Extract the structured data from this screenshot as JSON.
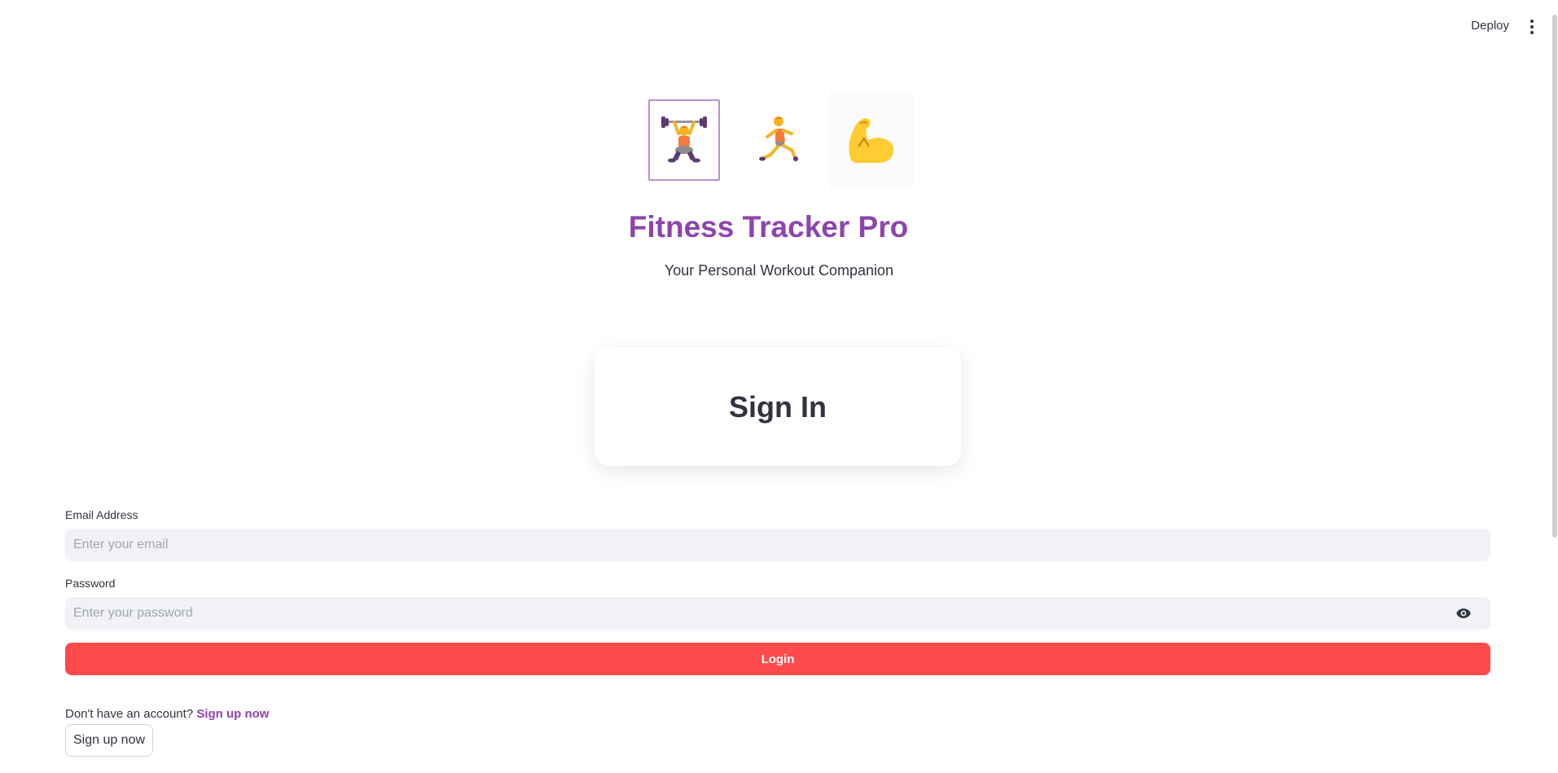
{
  "header": {
    "deploy_label": "Deploy",
    "menu_icon": "kebab-menu-icon"
  },
  "hero": {
    "icons": [
      "weightlifter-icon",
      "runner-icon",
      "flexed-biceps-icon"
    ],
    "title": "Fitness Tracker Pro",
    "subtitle": "Your Personal Workout Companion"
  },
  "card": {
    "heading": "Sign In"
  },
  "form": {
    "email_label": "Email Address",
    "email_placeholder": "Enter your email",
    "email_value": "",
    "password_label": "Password",
    "password_placeholder": "Enter your password",
    "password_value": "",
    "show_password_icon": "eye-icon",
    "login_label": "Login"
  },
  "signup": {
    "prompt": "Don't have an account?",
    "link_label": "Sign up now",
    "button_label": "Sign up now"
  },
  "colors": {
    "accent": "#8e44ad",
    "primary_button": "#ff4b4b",
    "input_bg": "#f0f2f6"
  }
}
